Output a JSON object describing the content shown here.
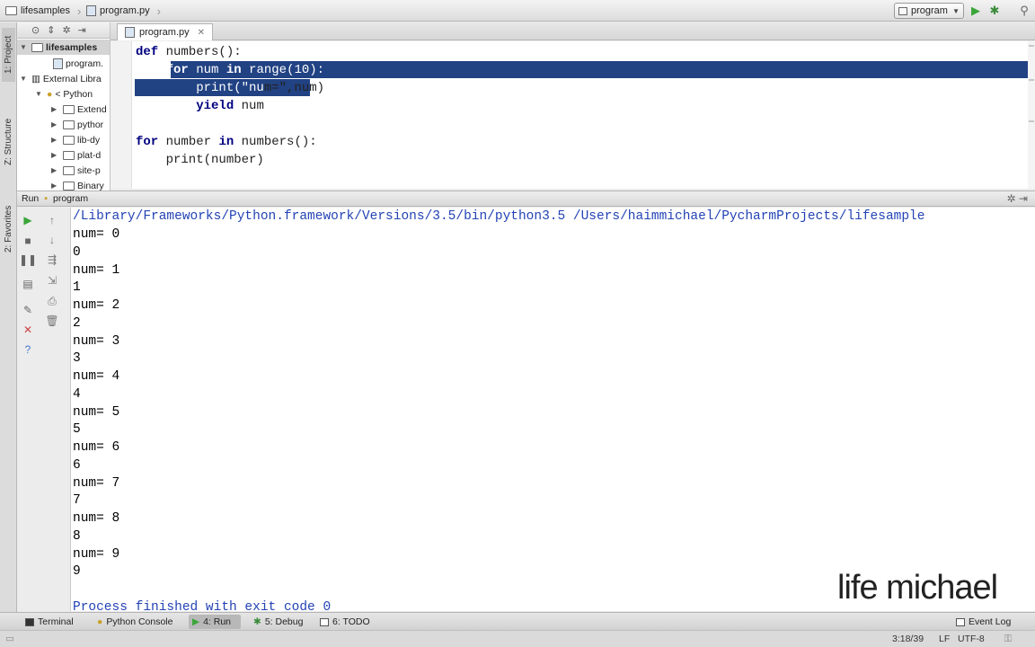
{
  "navbar": {
    "breadcrumbs": [
      {
        "label": "lifesamples",
        "icon": "folder-icon"
      },
      {
        "label": "program.py",
        "icon": "python-file-icon"
      }
    ],
    "run_config": "program"
  },
  "side_tabs": {
    "project": "1: Project",
    "structure": "Z: Structure",
    "favorites": "2: Favorites"
  },
  "project_tree": [
    {
      "label": "lifesamples",
      "expanded": true
    },
    {
      "label": "program."
    },
    {
      "label": "External Libra",
      "expanded": true
    },
    {
      "label": "< Python",
      "expanded": true
    },
    {
      "label": "Extend"
    },
    {
      "label": "pythor"
    },
    {
      "label": "lib-dy"
    },
    {
      "label": "plat-d"
    },
    {
      "label": "site-p"
    },
    {
      "label": "Binary"
    }
  ],
  "editor": {
    "tab_label": "program.py",
    "lines": [
      "def numbers():",
      "    for num in range(10):",
      "        print(\"num=\",num)",
      "        yield num",
      "",
      "for number in numbers():",
      "    print(number)"
    ]
  },
  "run_panel": {
    "title": "Run",
    "config": "program",
    "command": "/Library/Frameworks/Python.framework/Versions/3.5/bin/python3.5 /Users/haimmichael/PycharmProjects/lifesample",
    "output": [
      "num= 0",
      "0",
      "num= 1",
      "1",
      "num= 2",
      "2",
      "num= 3",
      "3",
      "num= 4",
      "4",
      "num= 5",
      "5",
      "num= 6",
      "6",
      "num= 7",
      "7",
      "num= 8",
      "8",
      "num= 9",
      "9",
      ""
    ],
    "exit_message": "Process finished with exit code 0"
  },
  "watermark": "life michael",
  "bottom_tabs": [
    {
      "label": "Terminal"
    },
    {
      "label": "Python Console"
    },
    {
      "label": "4: Run",
      "active": true
    },
    {
      "label": "5: Debug"
    },
    {
      "label": "6: TODO"
    }
  ],
  "event_log": "Event Log",
  "status": {
    "position": "3:18/39",
    "line_sep": "LF",
    "encoding": "UTF-8"
  },
  "colors": {
    "selection": "#214283",
    "keyword": "#000080",
    "string": "#008000",
    "command_text": "#2343b5",
    "run_green": "#3aa63a"
  }
}
